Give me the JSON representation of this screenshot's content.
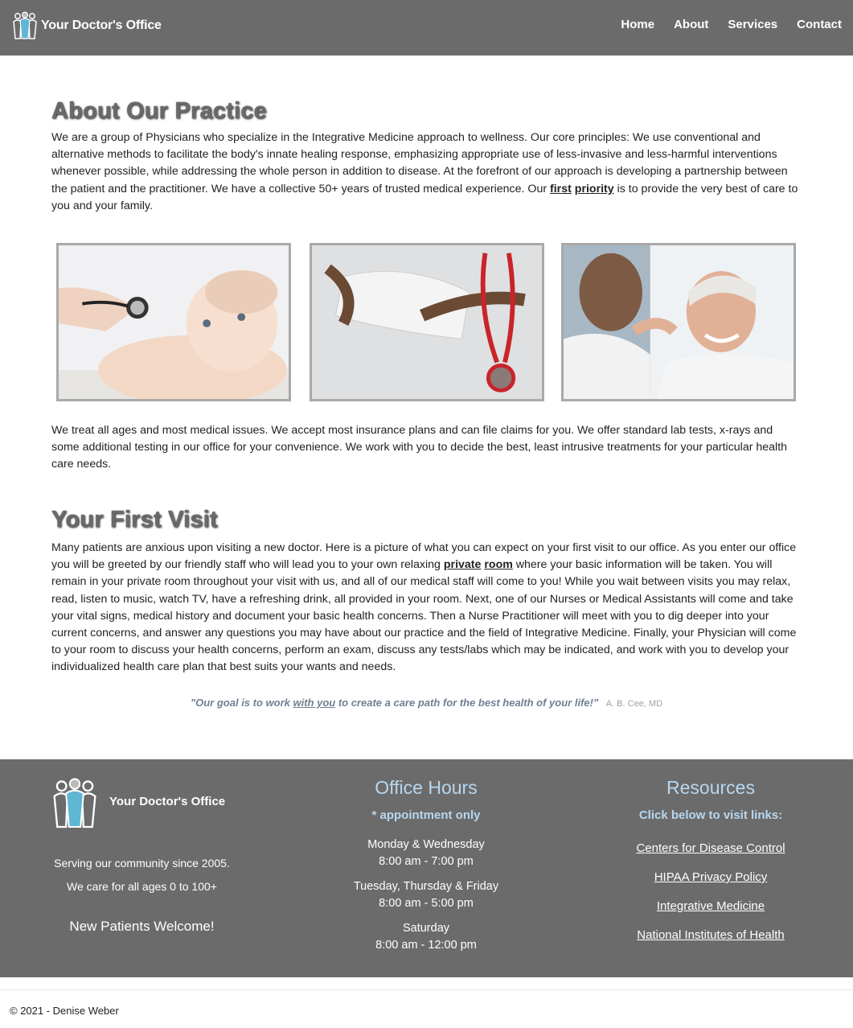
{
  "header": {
    "brand": "Your Doctor's Office",
    "nav": [
      "Home",
      "About",
      "Services",
      "Contact"
    ]
  },
  "about": {
    "title": "About Our Practice",
    "p1_before": "We are a group of Physicians who specialize in the Integrative Medicine approach to wellness. Our core principles: We use conventional and alternative methods to facilitate the body's innate healing response, emphasizing appropriate use of less-invasive and less-harmful interventions whenever possible, while addressing the whole person in addition to disease. At the forefront of our approach is developing a partnership between the patient and the practitioner. We have a collective 50+ years of trusted medical experience. Our ",
    "p1_link1": "first",
    "p1_link2": "priority",
    "p1_after": " is to provide the very best of care to you and your family.",
    "p2": "We treat all ages and most medical issues. We accept most insurance plans and can file claims for you. We offer standard lab tests, x-rays and some additional testing in our office for your convenience. We work with you to decide the best, least intrusive treatments for your particular health care needs."
  },
  "visit": {
    "title": "Your First Visit",
    "p_before": "Many patients are anxious upon visiting a new doctor. Here is a picture of what you can expect on your first visit to our office. As you enter our office you will be greeted by our friendly staff who will lead you to your own relaxing ",
    "link1": "private",
    "link2": "room",
    "p_after": " where your basic information will be taken. You will remain in your private room throughout your visit with us, and all of our medical staff will come to you! While you wait between visits you may relax, read, listen to music, watch TV, have a refreshing drink, all provided in your room. Next, one of our Nurses or Medical Assistants will come and take your vital signs, medical history and document your basic health concerns. Then a Nurse Practitioner will meet with you to dig deeper into your current concerns, and answer any questions you may have about our practice and the field of Integrative Medicine. Finally, your Physician will come to your room to discuss your health concerns, perform an exam, discuss any tests/labs which may be indicated, and work with you to develop your individualized health care plan that best suits your wants and needs."
  },
  "quote": {
    "before": "\"Our goal is to work ",
    "emph": "with you",
    "after": " to create a care path for the best health of your life!\"",
    "author": "A. B. Cee, MD"
  },
  "footer": {
    "brand": "Your Doctor's Office",
    "serving": "Serving our community since 2005.",
    "ages": "We care for all ages 0 to 100+",
    "welcome": "New Patients Welcome!",
    "hours_title": "Office Hours",
    "hours_note": "* appointment only",
    "hours": [
      {
        "days": "Monday & Wednesday",
        "time": "8:00 am - 7:00 pm"
      },
      {
        "days": "Tuesday, Thursday & Friday",
        "time": "8:00 am - 5:00 pm"
      },
      {
        "days": "Saturday",
        "time": "8:00 am - 12:00 pm"
      }
    ],
    "resources_title": "Resources",
    "resources_note": "Click below to visit links:",
    "links": [
      "Centers for Disease Control",
      "HIPAA Privacy Policy",
      "Integrative Medicine",
      "National Institutes of Health"
    ]
  },
  "copyright": "© 2021 - Denise Weber",
  "colors": {
    "header_bg": "#6b6b6b",
    "footer_bg": "#6b6b6b",
    "accent_light_blue": "#b8d7ef",
    "quote_text": "#6f7f93",
    "heading_gray": "#6a6a6a"
  },
  "icons": [
    "people-group-logo-icon"
  ]
}
